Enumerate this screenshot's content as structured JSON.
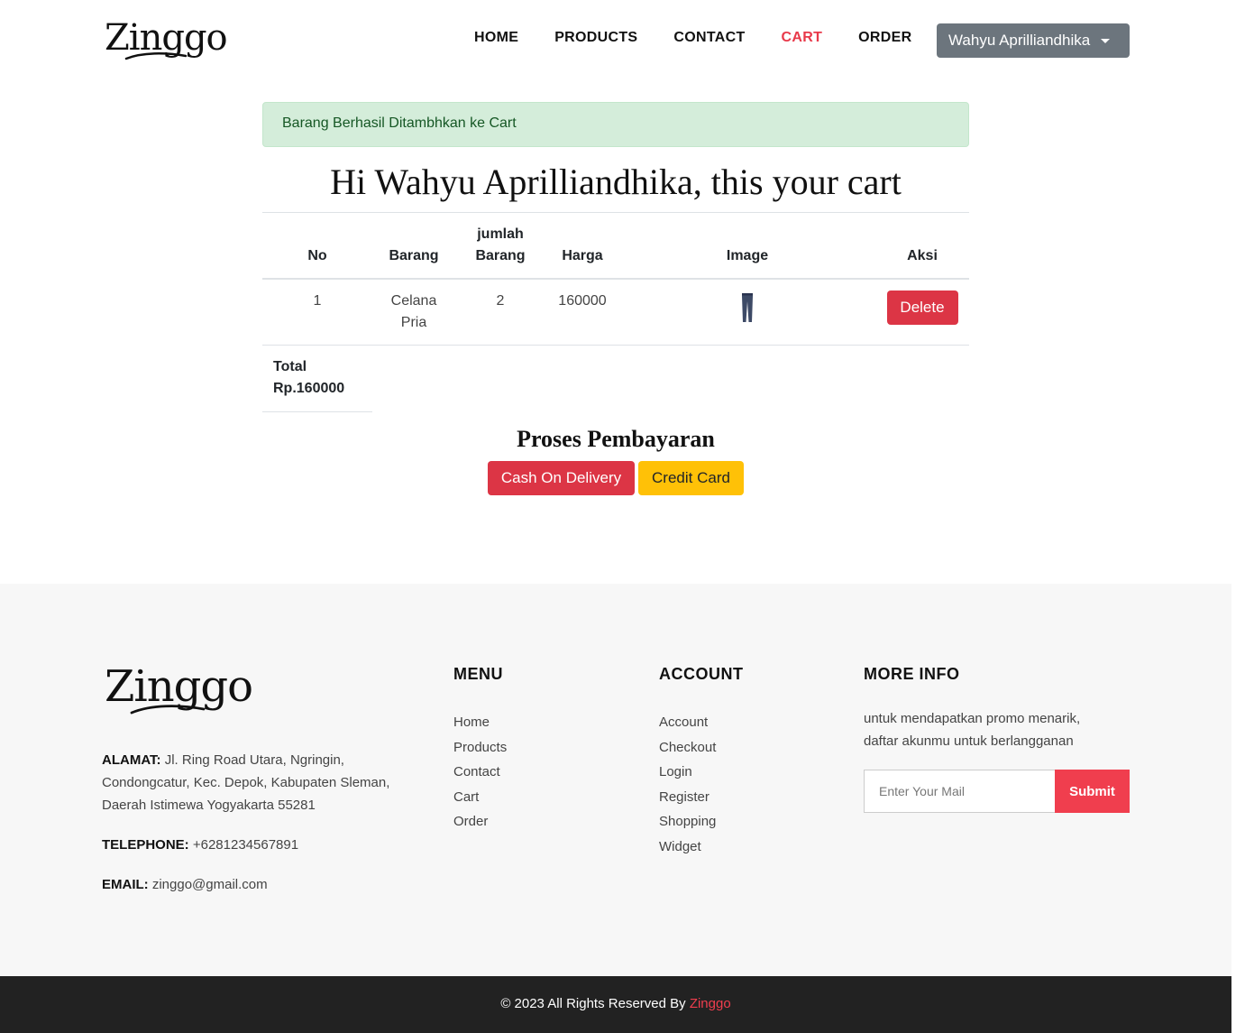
{
  "brand": "Zinggo",
  "nav": {
    "items": [
      "HOME",
      "PRODUCTS",
      "CONTACT",
      "CART",
      "ORDER"
    ],
    "active": "CART",
    "user": "Wahyu Aprilliandhika"
  },
  "alert": {
    "message": "Barang Berhasil Ditambhkan ke Cart"
  },
  "cart": {
    "title": "Hi Wahyu Aprilliandhika, this your cart",
    "headers": {
      "no": "No",
      "barang": "Barang",
      "jumlah_line1": "jumlah",
      "jumlah_line2": "Barang",
      "harga": "Harga",
      "image": "Image",
      "aksi": "Aksi"
    },
    "rows": [
      {
        "no": "1",
        "barang_line1": "Celana",
        "barang_line2": "Pria",
        "jumlah": "2",
        "harga": "160000",
        "image_icon": "pants-icon",
        "action": "Delete"
      }
    ],
    "total_label": "Total",
    "total_value": "Rp.160000"
  },
  "payment": {
    "title": "Proses Pembayaran",
    "cod_label": "Cash On Delivery",
    "cc_label": "Credit Card"
  },
  "footer": {
    "address_label": "ALAMAT:",
    "address_line1": "Jl. Ring Road Utara, Ngringin,",
    "address_line2": "Condongcatur, Kec. Depok, Kabupaten Sleman,",
    "address_line3": "Daerah Istimewa Yogyakarta 55281",
    "phone_label": "TELEPHONE:",
    "phone": "+6281234567891",
    "email_label": "EMAIL:",
    "email": "zinggo@gmail.com",
    "menu": {
      "heading": "MENU",
      "items": [
        "Home",
        "Products",
        "Contact",
        "Cart",
        "Order"
      ]
    },
    "account": {
      "heading": "ACCOUNT",
      "items": [
        "Account",
        "Checkout",
        "Login",
        "Register",
        "Shopping",
        "Widget"
      ]
    },
    "more": {
      "heading": "MORE INFO",
      "text_line1": "untuk mendapatkan promo menarik,",
      "text_line2": "daftar akunmu untuk berlangganan",
      "placeholder": "Enter Your Mail",
      "submit": "Submit"
    },
    "copyright": "© 2023 All Rights Reserved By",
    "copyright_brand": "Zinggo"
  },
  "colors": {
    "accent": "#e8394a",
    "delete": "#dc3545",
    "warning": "#ffc107",
    "alert_bg": "#d4edda",
    "user_btn": "#6c757d",
    "footer_bg": "#f7f7f7",
    "copyright_bg": "#222222"
  }
}
